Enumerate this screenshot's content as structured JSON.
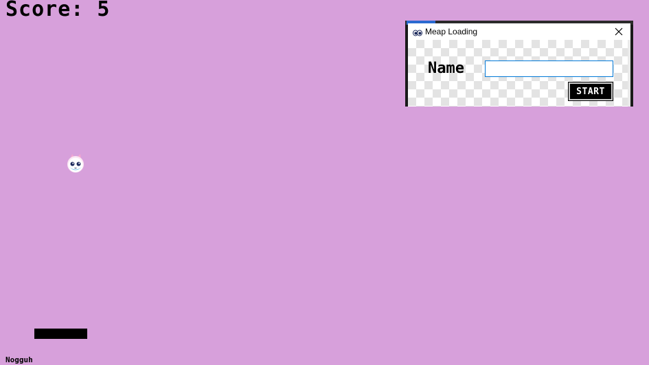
{
  "game": {
    "score_text": "Score: 5",
    "credit": "Nogguh",
    "background_color": "#d7a0db",
    "ball_icon": "cat-face-ball-icon",
    "paddle_color": "#000000"
  },
  "dialog": {
    "title": "Meap Loading",
    "app_icon": "eyes-icon",
    "close_icon": "close-icon",
    "name_label": "Name",
    "name_input": {
      "value": "",
      "placeholder": ""
    },
    "start_label": "START"
  }
}
